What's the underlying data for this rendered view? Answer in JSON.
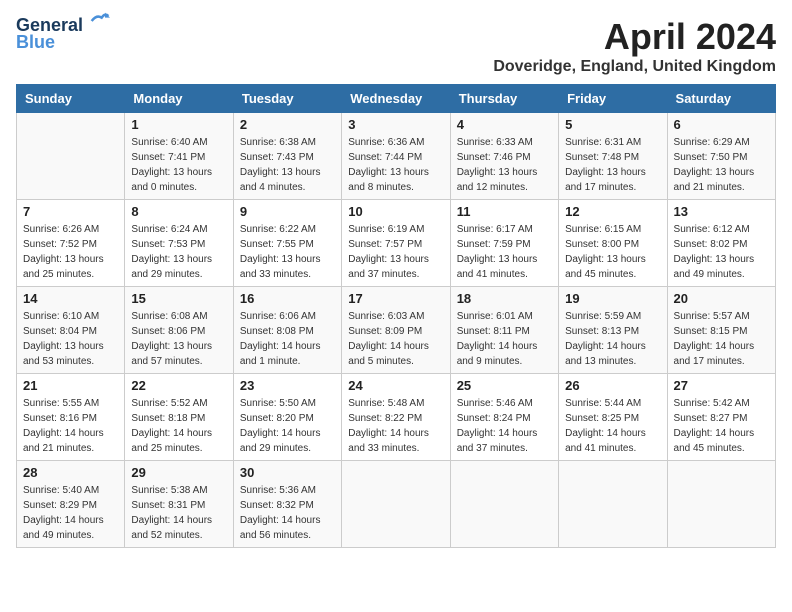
{
  "header": {
    "logo_line1": "General",
    "logo_line2": "Blue",
    "month_title": "April 2024",
    "location": "Doveridge, England, United Kingdom"
  },
  "days_of_week": [
    "Sunday",
    "Monday",
    "Tuesday",
    "Wednesday",
    "Thursday",
    "Friday",
    "Saturday"
  ],
  "weeks": [
    [
      {
        "day": "",
        "sunrise": "",
        "sunset": "",
        "daylight": ""
      },
      {
        "day": "1",
        "sunrise": "6:40 AM",
        "sunset": "7:41 PM",
        "daylight": "13 hours and 0 minutes."
      },
      {
        "day": "2",
        "sunrise": "6:38 AM",
        "sunset": "7:43 PM",
        "daylight": "13 hours and 4 minutes."
      },
      {
        "day": "3",
        "sunrise": "6:36 AM",
        "sunset": "7:44 PM",
        "daylight": "13 hours and 8 minutes."
      },
      {
        "day": "4",
        "sunrise": "6:33 AM",
        "sunset": "7:46 PM",
        "daylight": "13 hours and 12 minutes."
      },
      {
        "day": "5",
        "sunrise": "6:31 AM",
        "sunset": "7:48 PM",
        "daylight": "13 hours and 17 minutes."
      },
      {
        "day": "6",
        "sunrise": "6:29 AM",
        "sunset": "7:50 PM",
        "daylight": "13 hours and 21 minutes."
      }
    ],
    [
      {
        "day": "7",
        "sunrise": "6:26 AM",
        "sunset": "7:52 PM",
        "daylight": "13 hours and 25 minutes."
      },
      {
        "day": "8",
        "sunrise": "6:24 AM",
        "sunset": "7:53 PM",
        "daylight": "13 hours and 29 minutes."
      },
      {
        "day": "9",
        "sunrise": "6:22 AM",
        "sunset": "7:55 PM",
        "daylight": "13 hours and 33 minutes."
      },
      {
        "day": "10",
        "sunrise": "6:19 AM",
        "sunset": "7:57 PM",
        "daylight": "13 hours and 37 minutes."
      },
      {
        "day": "11",
        "sunrise": "6:17 AM",
        "sunset": "7:59 PM",
        "daylight": "13 hours and 41 minutes."
      },
      {
        "day": "12",
        "sunrise": "6:15 AM",
        "sunset": "8:00 PM",
        "daylight": "13 hours and 45 minutes."
      },
      {
        "day": "13",
        "sunrise": "6:12 AM",
        "sunset": "8:02 PM",
        "daylight": "13 hours and 49 minutes."
      }
    ],
    [
      {
        "day": "14",
        "sunrise": "6:10 AM",
        "sunset": "8:04 PM",
        "daylight": "13 hours and 53 minutes."
      },
      {
        "day": "15",
        "sunrise": "6:08 AM",
        "sunset": "8:06 PM",
        "daylight": "13 hours and 57 minutes."
      },
      {
        "day": "16",
        "sunrise": "6:06 AM",
        "sunset": "8:08 PM",
        "daylight": "14 hours and 1 minute."
      },
      {
        "day": "17",
        "sunrise": "6:03 AM",
        "sunset": "8:09 PM",
        "daylight": "14 hours and 5 minutes."
      },
      {
        "day": "18",
        "sunrise": "6:01 AM",
        "sunset": "8:11 PM",
        "daylight": "14 hours and 9 minutes."
      },
      {
        "day": "19",
        "sunrise": "5:59 AM",
        "sunset": "8:13 PM",
        "daylight": "14 hours and 13 minutes."
      },
      {
        "day": "20",
        "sunrise": "5:57 AM",
        "sunset": "8:15 PM",
        "daylight": "14 hours and 17 minutes."
      }
    ],
    [
      {
        "day": "21",
        "sunrise": "5:55 AM",
        "sunset": "8:16 PM",
        "daylight": "14 hours and 21 minutes."
      },
      {
        "day": "22",
        "sunrise": "5:52 AM",
        "sunset": "8:18 PM",
        "daylight": "14 hours and 25 minutes."
      },
      {
        "day": "23",
        "sunrise": "5:50 AM",
        "sunset": "8:20 PM",
        "daylight": "14 hours and 29 minutes."
      },
      {
        "day": "24",
        "sunrise": "5:48 AM",
        "sunset": "8:22 PM",
        "daylight": "14 hours and 33 minutes."
      },
      {
        "day": "25",
        "sunrise": "5:46 AM",
        "sunset": "8:24 PM",
        "daylight": "14 hours and 37 minutes."
      },
      {
        "day": "26",
        "sunrise": "5:44 AM",
        "sunset": "8:25 PM",
        "daylight": "14 hours and 41 minutes."
      },
      {
        "day": "27",
        "sunrise": "5:42 AM",
        "sunset": "8:27 PM",
        "daylight": "14 hours and 45 minutes."
      }
    ],
    [
      {
        "day": "28",
        "sunrise": "5:40 AM",
        "sunset": "8:29 PM",
        "daylight": "14 hours and 49 minutes."
      },
      {
        "day": "29",
        "sunrise": "5:38 AM",
        "sunset": "8:31 PM",
        "daylight": "14 hours and 52 minutes."
      },
      {
        "day": "30",
        "sunrise": "5:36 AM",
        "sunset": "8:32 PM",
        "daylight": "14 hours and 56 minutes."
      },
      {
        "day": "",
        "sunrise": "",
        "sunset": "",
        "daylight": ""
      },
      {
        "day": "",
        "sunrise": "",
        "sunset": "",
        "daylight": ""
      },
      {
        "day": "",
        "sunrise": "",
        "sunset": "",
        "daylight": ""
      },
      {
        "day": "",
        "sunrise": "",
        "sunset": "",
        "daylight": ""
      }
    ]
  ]
}
